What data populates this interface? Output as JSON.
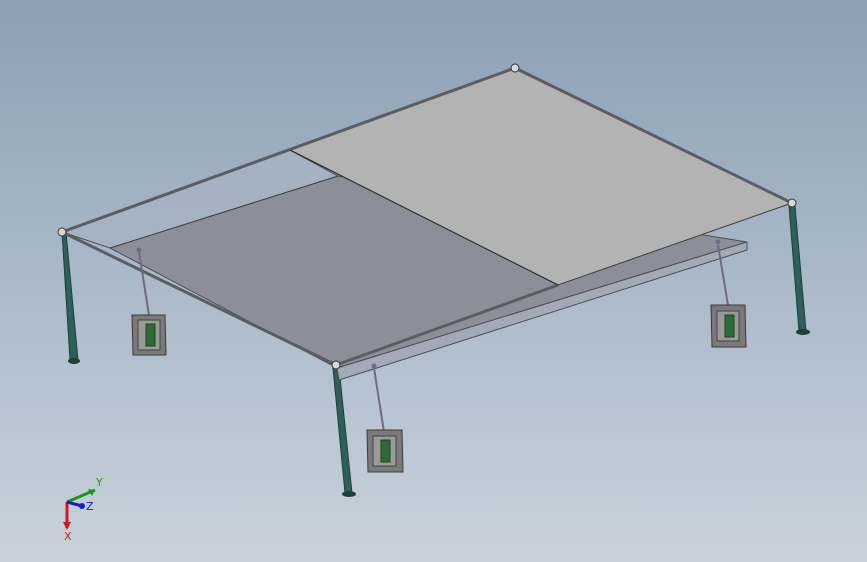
{
  "viewport": {
    "background_top": "#8c9fb4",
    "background_bottom": "#c9d2dc"
  },
  "model": {
    "panel_light_color": "#b3b3b3",
    "panel_dark_color": "#8c8f9a",
    "glass_color": "#a7b3c2",
    "frame_color": "#2f5f5a",
    "bracket_color": "#7a7a7a",
    "bracket_accent_color": "#2e6a33"
  },
  "triad": {
    "x_label": "X",
    "y_label": "Y",
    "z_label": "Z",
    "x_color": "#d11a1a",
    "y_color": "#1a9a1a",
    "z_color": "#1a1ad1"
  }
}
